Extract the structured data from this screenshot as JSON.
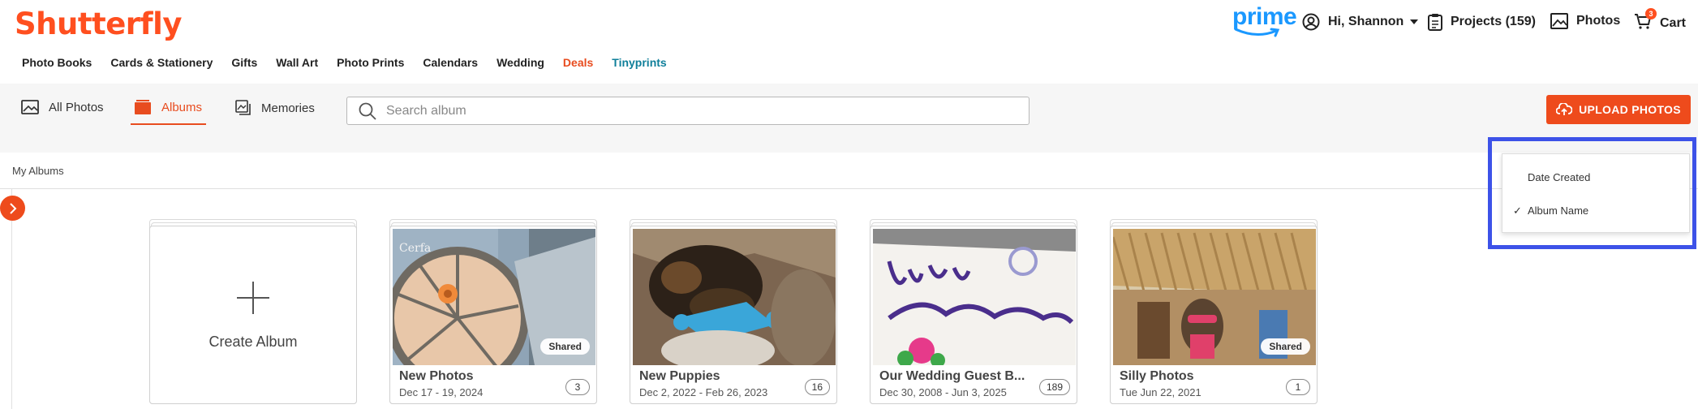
{
  "header": {
    "logo": "Shutterfly",
    "prime": "prime",
    "account_label": "Hi, Shannon",
    "projects_label": "Projects (159)",
    "photos_label": "Photos",
    "cart_label": "Cart",
    "cart_count": "3"
  },
  "nav": {
    "items": [
      "Photo Books",
      "Cards & Stationery",
      "Gifts",
      "Wall Art",
      "Photo Prints",
      "Calendars",
      "Wedding",
      "Deals",
      "Tinyprints"
    ]
  },
  "toolbar": {
    "tabs": [
      "All Photos",
      "Albums",
      "Memories"
    ],
    "active_tab": "Albums",
    "search_placeholder": "Search album",
    "upload_label": "UPLOAD PHOTOS"
  },
  "section": {
    "title": "My Albums"
  },
  "create_album": {
    "label": "Create Album"
  },
  "albums": [
    {
      "title": "New Photos",
      "date": "Dec 17 - 19, 2024",
      "count": "3",
      "shared": "Shared"
    },
    {
      "title": "New Puppies",
      "date": "Dec 2, 2022 - Feb 26, 2023",
      "count": "16",
      "shared": ""
    },
    {
      "title": "Our Wedding Guest B...",
      "date": "Dec 30, 2008 - Jun 3, 2025",
      "count": "189",
      "shared": ""
    },
    {
      "title": "Silly Photos",
      "date": "Tue Jun 22, 2021",
      "count": "1",
      "shared": "Shared"
    }
  ],
  "sort_menu": {
    "options": [
      "Date Created",
      "Album Name"
    ],
    "selected": "Album Name",
    "check": "✓"
  },
  "colors": {
    "brand": "#ff4f1f",
    "highlight": "#3d52e8",
    "prime": "#1a98ff"
  }
}
